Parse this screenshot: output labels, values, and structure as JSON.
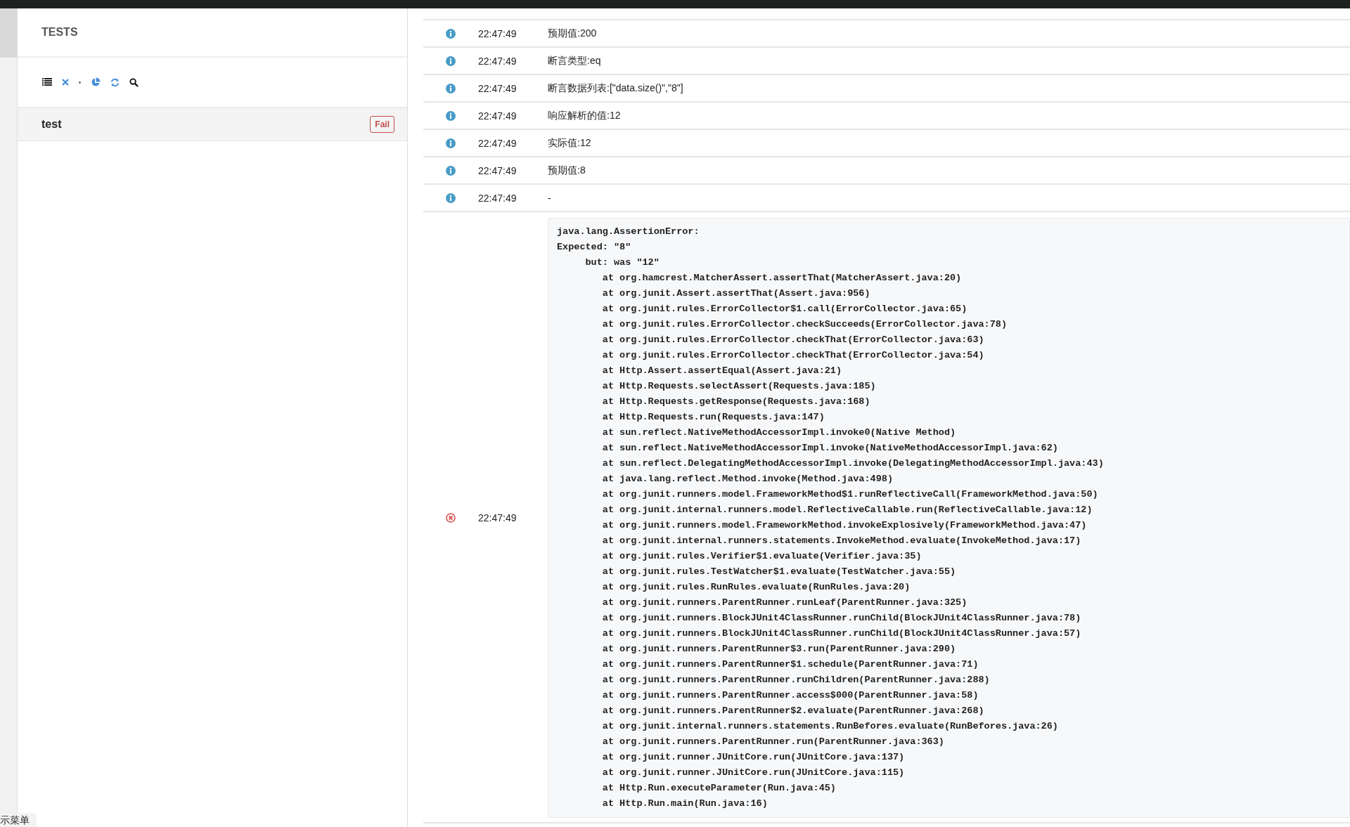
{
  "tests_panel": {
    "title": "TESTS",
    "toolbar": [
      {
        "kind": "list"
      },
      {
        "kind": "close"
      },
      {
        "kind": "dot"
      },
      {
        "kind": "chart"
      },
      {
        "kind": "refresh"
      },
      {
        "kind": "search"
      }
    ],
    "tests": [
      {
        "name": "test",
        "status": "Fail",
        "selected": true
      }
    ]
  },
  "log": [
    {
      "kind": "info",
      "time": "22:47:49",
      "message": "预期值:200"
    },
    {
      "kind": "info",
      "time": "22:47:49",
      "message": "断言类型:eq"
    },
    {
      "kind": "info",
      "time": "22:47:49",
      "message": "断言数据列表:[\"data.size()\",\"8\"]"
    },
    {
      "kind": "info",
      "time": "22:47:49",
      "message": "响应解析的值:12"
    },
    {
      "kind": "info",
      "time": "22:47:49",
      "message": "实际值:12"
    },
    {
      "kind": "info",
      "time": "22:47:49",
      "message": "预期值:8"
    },
    {
      "kind": "info",
      "time": "22:47:49",
      "message": "-"
    },
    {
      "kind": "error",
      "time": "22:47:49",
      "stack": [
        "java.lang.AssertionError:",
        "Expected: \"8\"",
        "     but: was \"12\"",
        "        at org.hamcrest.MatcherAssert.assertThat(MatcherAssert.java:20)",
        "        at org.junit.Assert.assertThat(Assert.java:956)",
        "        at org.junit.rules.ErrorCollector$1.call(ErrorCollector.java:65)",
        "        at org.junit.rules.ErrorCollector.checkSucceeds(ErrorCollector.java:78)",
        "        at org.junit.rules.ErrorCollector.checkThat(ErrorCollector.java:63)",
        "        at org.junit.rules.ErrorCollector.checkThat(ErrorCollector.java:54)",
        "        at Http.Assert.assertEqual(Assert.java:21)",
        "        at Http.Requests.selectAssert(Requests.java:185)",
        "        at Http.Requests.getResponse(Requests.java:168)",
        "        at Http.Requests.run(Requests.java:147)",
        "        at sun.reflect.NativeMethodAccessorImpl.invoke0(Native Method)",
        "        at sun.reflect.NativeMethodAccessorImpl.invoke(NativeMethodAccessorImpl.java:62)",
        "        at sun.reflect.DelegatingMethodAccessorImpl.invoke(DelegatingMethodAccessorImpl.java:43)",
        "        at java.lang.reflect.Method.invoke(Method.java:498)",
        "        at org.junit.runners.model.FrameworkMethod$1.runReflectiveCall(FrameworkMethod.java:50)",
        "        at org.junit.internal.runners.model.ReflectiveCallable.run(ReflectiveCallable.java:12)",
        "        at org.junit.runners.model.FrameworkMethod.invokeExplosively(FrameworkMethod.java:47)",
        "        at org.junit.internal.runners.statements.InvokeMethod.evaluate(InvokeMethod.java:17)",
        "        at org.junit.rules.Verifier$1.evaluate(Verifier.java:35)",
        "        at org.junit.rules.TestWatcher$1.evaluate(TestWatcher.java:55)",
        "        at org.junit.rules.RunRules.evaluate(RunRules.java:20)",
        "        at org.junit.runners.ParentRunner.runLeaf(ParentRunner.java:325)",
        "        at org.junit.runners.BlockJUnit4ClassRunner.runChild(BlockJUnit4ClassRunner.java:78)",
        "        at org.junit.runners.BlockJUnit4ClassRunner.runChild(BlockJUnit4ClassRunner.java:57)",
        "        at org.junit.runners.ParentRunner$3.run(ParentRunner.java:290)",
        "        at org.junit.runners.ParentRunner$1.schedule(ParentRunner.java:71)",
        "        at org.junit.runners.ParentRunner.runChildren(ParentRunner.java:288)",
        "        at org.junit.runners.ParentRunner.access$000(ParentRunner.java:58)",
        "        at org.junit.runners.ParentRunner$2.evaluate(ParentRunner.java:268)",
        "        at org.junit.internal.runners.statements.RunBefores.evaluate(RunBefores.java:26)",
        "        at org.junit.runners.ParentRunner.run(ParentRunner.java:363)",
        "        at org.junit.runner.JUnitCore.run(JUnitCore.java:137)",
        "        at org.junit.runner.JUnitCore.run(JUnitCore.java:115)",
        "        at Http.Run.executeParameter(Run.java:45)",
        "        at Http.Run.main(Run.java:16)"
      ]
    }
  ],
  "menu_tab": "示菜单"
}
